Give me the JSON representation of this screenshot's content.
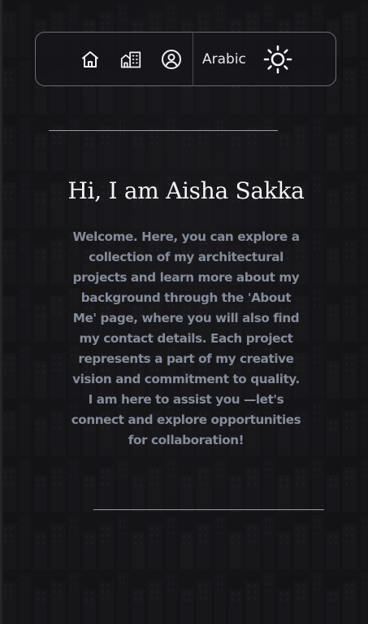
{
  "nav": {
    "home_icon": "home-icon",
    "projects_icon": "buildings-icon",
    "about_icon": "user-circle-icon",
    "language_label": "Arabic",
    "theme_icon": "sun-icon"
  },
  "hero": {
    "title": "Hi, I am Aisha Sakka",
    "intro": "Welcome. Here, you can explore a collection of my architectural projects and learn more about my background through the 'About Me' page, where you will also find my contact details. Each project represents a part of my creative vision and commitment to quality. I am here to assist you —let's connect and explore opportunities for collaboration!"
  },
  "colors": {
    "background": "#131316",
    "nav_border": "#6c6c72",
    "title": "#f4f4f6",
    "intro_text": "#858b99",
    "divider": "#9a9aa0"
  }
}
